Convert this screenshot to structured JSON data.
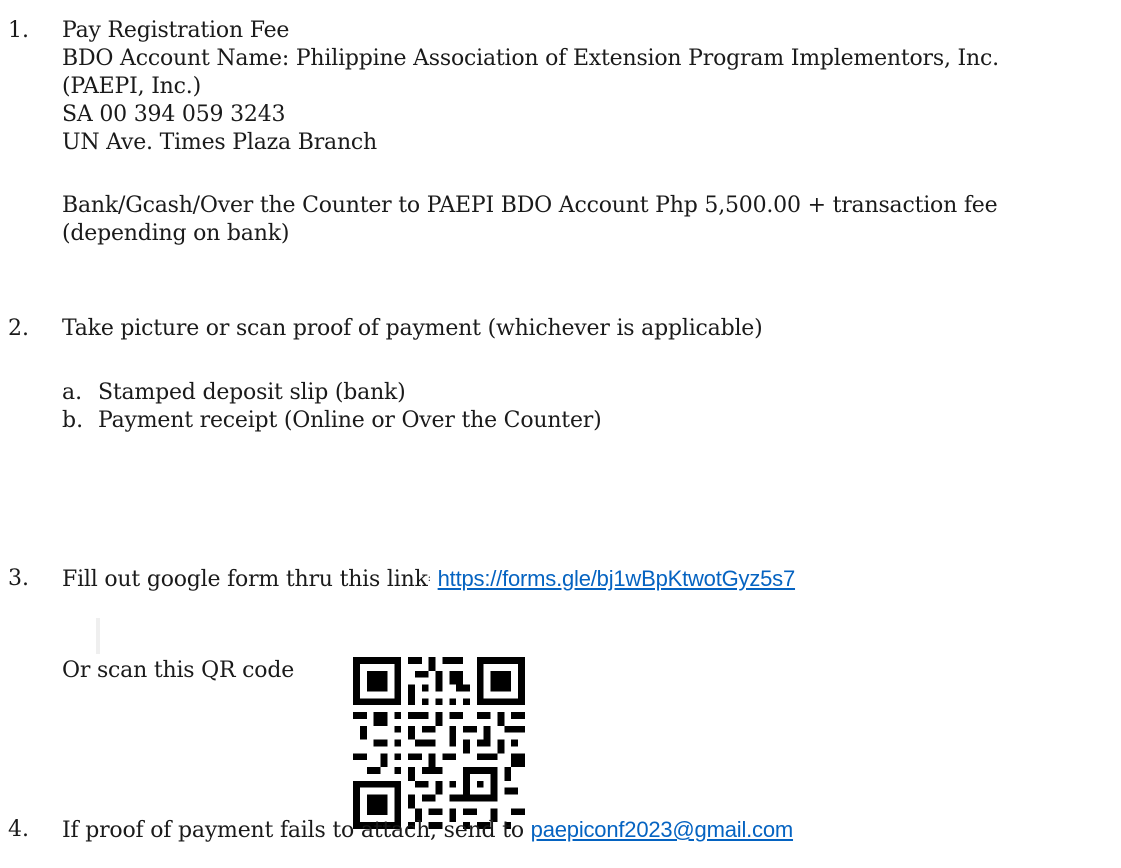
{
  "steps": [
    {
      "number": "1.",
      "title": "Pay Registration Fee",
      "account_name_line1": "BDO Account Name: Philippine Association of Extension Program Implementors, Inc.",
      "account_name_line2": "(PAEPI, Inc.)",
      "account_number": "SA 00 394 059 3243",
      "branch": "UN Ave. Times Plaza Branch",
      "payment_line1": "Bank/Gcash/Over the Counter to PAEPI BDO Account Php 5,500.00 + transaction fee",
      "payment_line2": "(depending on bank)"
    },
    {
      "number": "2.",
      "title": "Take picture or scan proof of payment (whichever is applicable)",
      "sub_items": [
        {
          "letter": "a.",
          "text": "Stamped deposit slip (bank)"
        },
        {
          "letter": "b.",
          "text": "Payment receipt (Online or Over the Counter)"
        }
      ]
    },
    {
      "number": "3.",
      "title": "Fill out google form thru this link",
      "link_separator": ":",
      "link": "https://forms.gle/bj1wBpKtwotGyz5s7",
      "qr_caption": "Or scan this QR code"
    },
    {
      "number": "4.",
      "title": "If proof of payment fails to attach, send to ",
      "email": "paepiconf2023@gmail.com"
    }
  ],
  "icons": {
    "qr_code": "qr-code-icon"
  },
  "colors": {
    "link": "#0563c1",
    "text": "#1a1a1a"
  }
}
